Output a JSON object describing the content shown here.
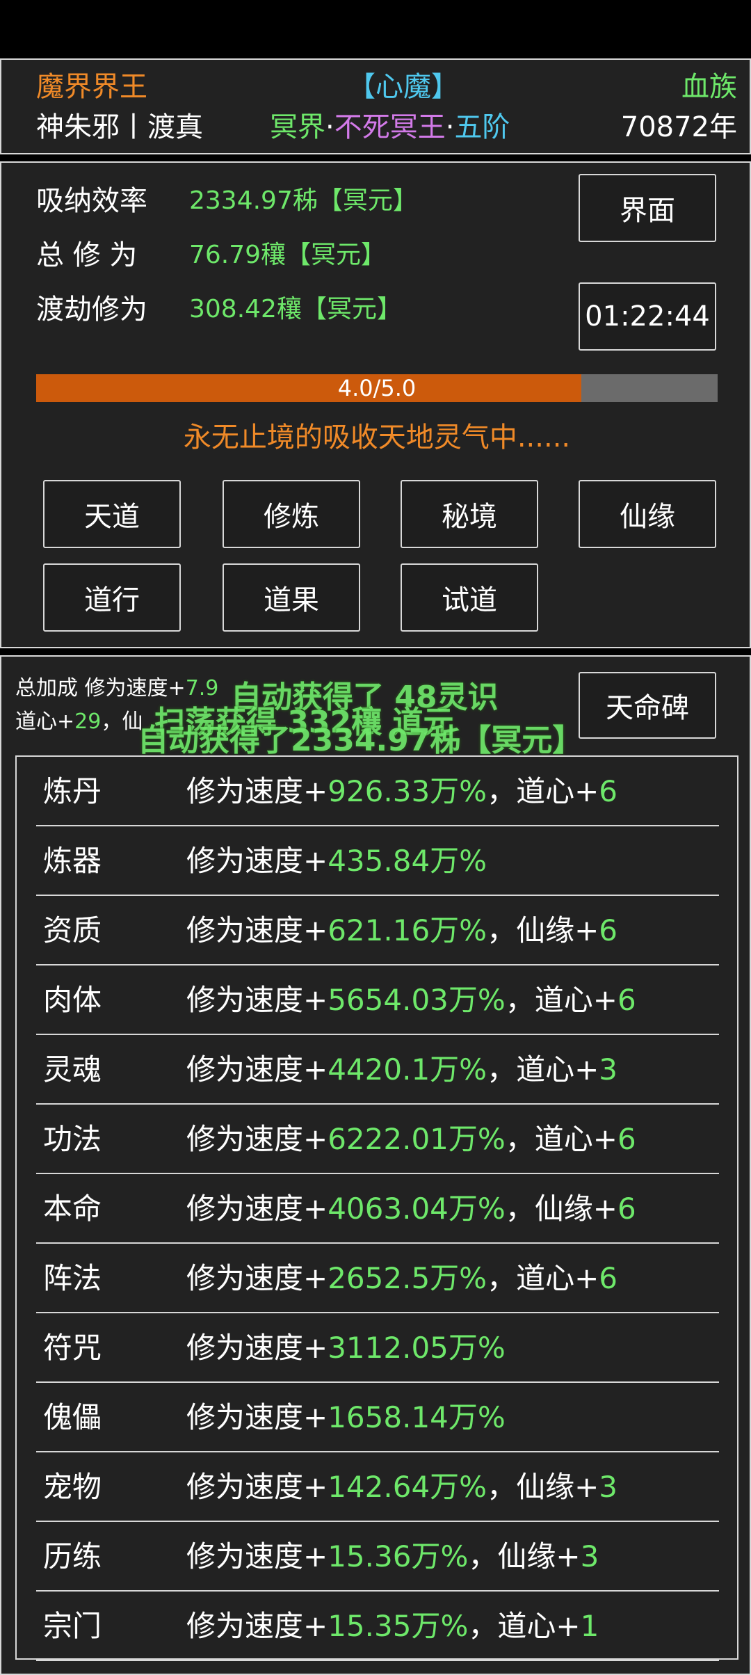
{
  "header": {
    "realm_title": "魔界界王",
    "status": "【心魔】",
    "race": "血族",
    "player_name": "神朱邪丨渡真",
    "realm_name": "冥界",
    "sep1": "·",
    "rank_name": "不死冥王",
    "sep2": "·",
    "stage": "五阶",
    "age": "70872年"
  },
  "stats": {
    "absorb_label": "吸纳效率",
    "absorb_value": "2334.97秭【冥元】",
    "total_label": "总 修 为",
    "total_value": "76.79穰【冥元】",
    "tribulation_label": "渡劫修为",
    "tribulation_value": "308.42穰【冥元】",
    "interface_button": "界面",
    "timer": "01:22:44"
  },
  "progress": {
    "text": "4.0/5.0",
    "current": 4.0,
    "max": 5.0
  },
  "status_message": "永无止境的吸收天地灵气中......",
  "nav": {
    "tiandao": "天道",
    "xiulian": "修炼",
    "mijing": "秘境",
    "xianyuan": "仙缘",
    "daoxing": "道行",
    "daoguo": "道果",
    "shidao": "试道"
  },
  "bonus": {
    "line1_label": "总加成 修为速度+",
    "line1_value": "7.9",
    "line2_label": "道心+",
    "line2_value": "29",
    "line2_tail": "，仙"
  },
  "tianming_button": "天命碑",
  "messages": {
    "msg1": "自动获得了 48灵识",
    "msg2": "扫荡获得 332穰 道元",
    "msg3": "自动获得了2334.97秭【冥元】"
  },
  "skills": [
    {
      "name": "炼丹",
      "prefix": "修为速度+",
      "value": "926.33万%",
      "extra_label": "，道心+",
      "extra_value": "6"
    },
    {
      "name": "炼器",
      "prefix": "修为速度+",
      "value": "435.84万%",
      "extra_label": "",
      "extra_value": ""
    },
    {
      "name": "资质",
      "prefix": "修为速度+",
      "value": "621.16万%",
      "extra_label": "，仙缘+",
      "extra_value": "6"
    },
    {
      "name": "肉体",
      "prefix": "修为速度+",
      "value": "5654.03万%",
      "extra_label": "，道心+",
      "extra_value": "6"
    },
    {
      "name": "灵魂",
      "prefix": "修为速度+",
      "value": "4420.1万%",
      "extra_label": "，道心+",
      "extra_value": "3"
    },
    {
      "name": "功法",
      "prefix": "修为速度+",
      "value": "6222.01万%",
      "extra_label": "，道心+",
      "extra_value": "6"
    },
    {
      "name": "本命",
      "prefix": "修为速度+",
      "value": "4063.04万%",
      "extra_label": "，仙缘+",
      "extra_value": "6"
    },
    {
      "name": "阵法",
      "prefix": "修为速度+",
      "value": "2652.5万%",
      "extra_label": "，道心+",
      "extra_value": "6"
    },
    {
      "name": "符咒",
      "prefix": "修为速度+",
      "value": "3112.05万%",
      "extra_label": "",
      "extra_value": ""
    },
    {
      "name": "傀儡",
      "prefix": "修为速度+",
      "value": "1658.14万%",
      "extra_label": "",
      "extra_value": ""
    },
    {
      "name": "宠物",
      "prefix": "修为速度+",
      "value": "142.64万%",
      "extra_label": "，仙缘+",
      "extra_value": "3"
    },
    {
      "name": "历练",
      "prefix": "修为速度+",
      "value": "15.36万%",
      "extra_label": "，仙缘+",
      "extra_value": "3"
    },
    {
      "name": "宗门",
      "prefix": "修为速度+",
      "value": "15.35万%",
      "extra_label": "，道心+",
      "extra_value": "1"
    }
  ]
}
